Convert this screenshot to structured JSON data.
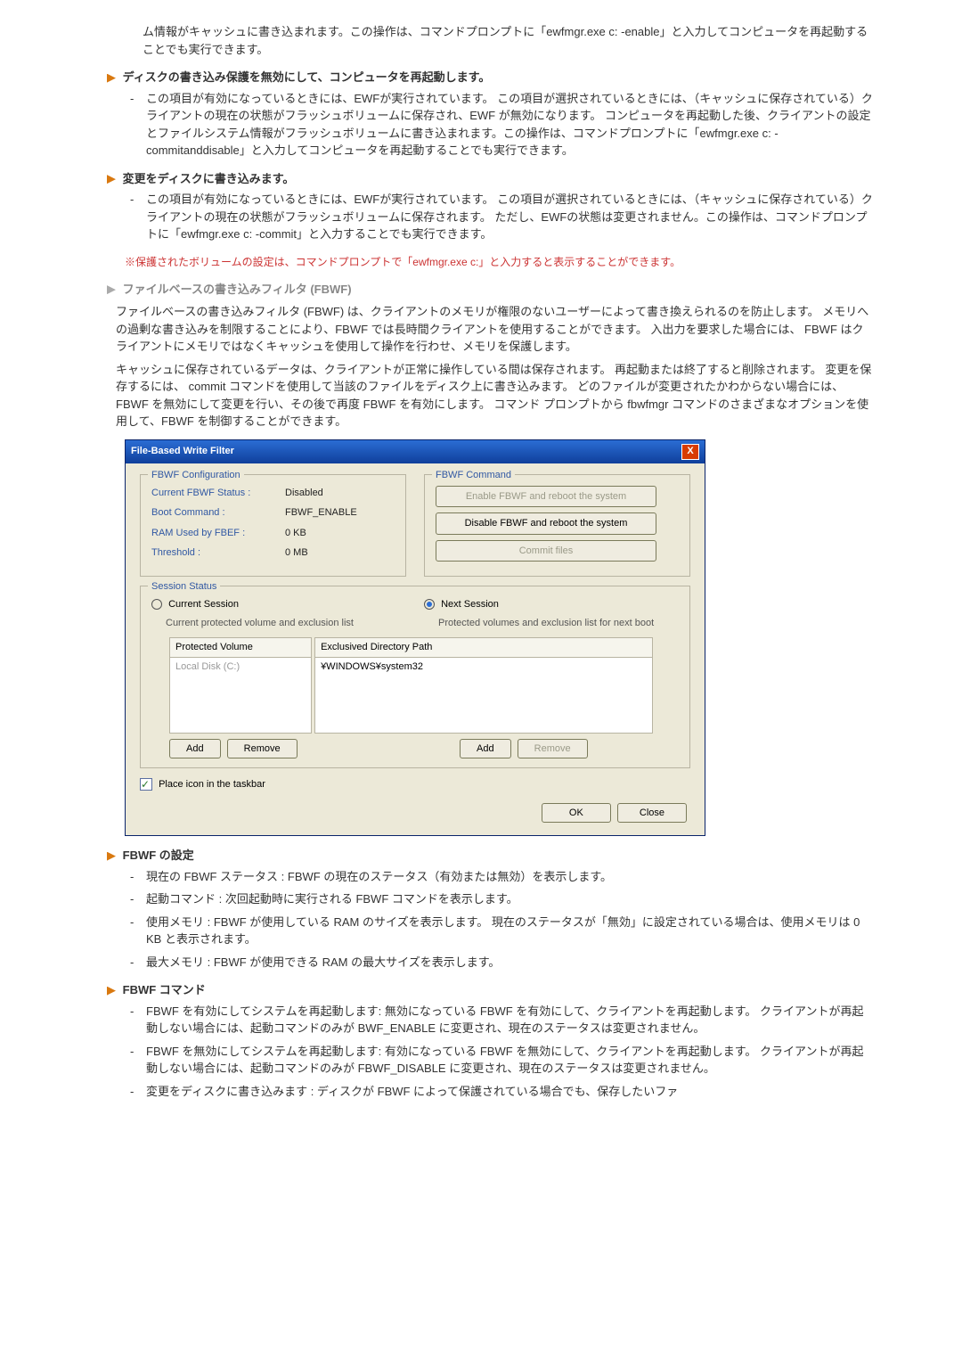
{
  "intro": "ム情報がキャッシュに書き込まれます。この操作は、コマンドプロンプトに「ewfmgr.exe c: -enable」と入力してコンピュータを再起動することでも実行できます。",
  "sec1": {
    "title": "ディスクの書き込み保護を無効にして、コンピュータを再起動します。",
    "item": "この項目が有効になっているときには、EWFが実行されています。 この項目が選択されているときには、（キャッシュに保存されている）クライアントの現在の状態がフラッシュボリュームに保存され、EWF が無効になります。 コンピュータを再起動した後、クライアントの設定とファイルシステム情報がフラッシュボリュームに書き込まれます。この操作は、コマンドプロンプトに「ewfmgr.exe c: -commitanddisable」と入力してコンピュータを再起動することでも実行できます。"
  },
  "sec2": {
    "title": "変更をディスクに書き込みます。",
    "item": "この項目が有効になっているときには、EWFが実行されています。 この項目が選択されているときには、（キャッシュに保存されている）クライアントの現在の状態がフラッシュボリュームに保存されます。 ただし、EWFの状態は変更されません。この操作は、コマンドプロンプトに「ewfmgr.exe c: -commit」と入力することでも実行できます。"
  },
  "note": "※保護されたボリュームの設定は、コマンドプロンプトで「ewfmgr.exe c:」と入力すると表示することができます。",
  "fbwf": {
    "title": "ファイルベースの書き込みフィルタ (FBWF)",
    "p1": "ファイルベースの書き込みフィルタ (FBWF) は、クライアントのメモリが権限のないユーザーによって書き換えられるのを防止します。 メモリへの過剰な書き込みを制限することにより、FBWF では長時間クライアントを使用することができます。 入出力を要求した場合には、 FBWF はクライアントにメモリではなくキャッシュを使用して操作を行わせ、メモリを保護します。",
    "p2": "キャッシュに保存されているデータは、クライアントが正常に操作している間は保存されます。 再起動または終了すると削除されます。 変更を保存するには、 commit コマンドを使用して当該のファイルをディスク上に書き込みます。 どのファイルが変更されたかわからない場合には、 FBWF を無効にして変更を行い、その後で再度 FBWF を有効にします。 コマンド プロンプトから fbwfmgr コマンドのさまざまなオプションを使用して、FBWF を制御することができます。"
  },
  "dialog": {
    "title": "File-Based Write Filter",
    "cfg_legend": "FBWF Configuration",
    "cmd_legend": "FBWF Command",
    "status_lbl": "Current FBWF Status :",
    "status_val": "Disabled",
    "boot_lbl": "Boot Command :",
    "boot_val": "FBWF_ENABLE",
    "ram_lbl": "RAM Used by FBEF :",
    "ram_val": "0 KB",
    "thr_lbl": "Threshold :",
    "thr_val": "0 MB",
    "btn_enable": "Enable FBWF and reboot the system",
    "btn_disable": "Disable FBWF and reboot the system",
    "btn_commit": "Commit files",
    "session_legend": "Session Status",
    "radio_cur": "Current Session",
    "radio_cur_sub": "Current  protected volume and exclusion list",
    "radio_next": "Next Session",
    "radio_next_sub": "Protected volumes and exclusion list for next boot",
    "col_vol": "Protected Volume",
    "col_vol_item": "Local Disk (C:)",
    "col_exc": "Exclusived Directory Path",
    "col_exc_item": "¥WINDOWS¥system32",
    "add": "Add",
    "remove": "Remove",
    "taskbar": "Place icon in the taskbar",
    "ok": "OK",
    "close": "Close"
  },
  "setting": {
    "title": "FBWF の設定",
    "i1": "現在の FBWF ステータス : FBWF の現在のステータス（有効または無効）を表示します。",
    "i2": "起動コマンド : 次回起動時に実行される FBWF コマンドを表示します。",
    "i3": "使用メモリ : FBWF が使用している RAM のサイズを表示します。 現在のステータスが「無効」に設定されている場合は、使用メモリは 0 KB と表示されます。",
    "i4": "最大メモリ : FBWF が使用できる RAM の最大サイズを表示します。"
  },
  "cmd": {
    "title": "FBWF コマンド",
    "i1": "FBWF を有効にしてシステムを再起動します: 無効になっている FBWF を有効にして、クライアントを再起動します。 クライアントが再起動しない場合には、起動コマンドのみが BWF_ENABLE に変更され、現在のステータスは変更されません。",
    "i2": "FBWF を無効にしてシステムを再起動します: 有効になっている FBWF を無効にして、クライアントを再起動します。 クライアントが再起動しない場合には、起動コマンドのみが FBWF_DISABLE に変更され、現在のステータスは変更されません。",
    "i3": "変更をディスクに書き込みます : ディスクが FBWF によって保護されている場合でも、保存したいファ"
  }
}
